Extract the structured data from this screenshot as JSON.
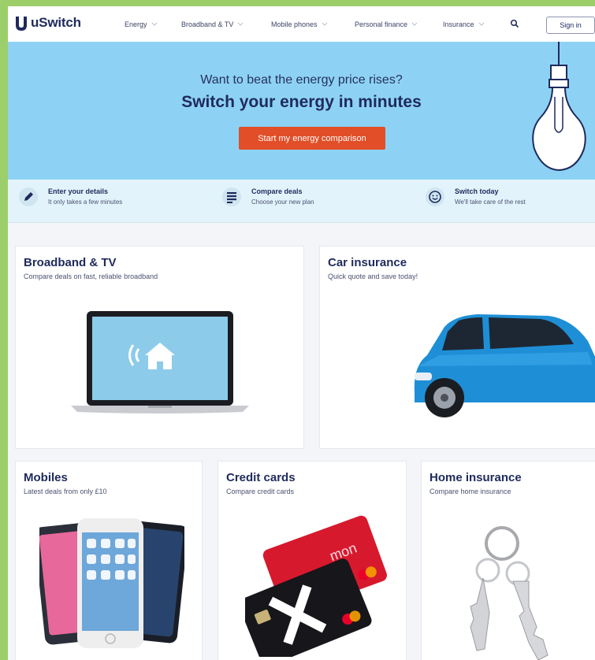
{
  "header": {
    "logo_text": "uSwitch",
    "nav": [
      "Energy",
      "Broadband & TV",
      "Mobile phones",
      "Personal finance",
      "Insurance"
    ],
    "sign_in": "Sign in"
  },
  "hero": {
    "subtitle": "Want to beat the energy price rises?",
    "title": "Switch your energy in minutes",
    "cta": "Start my energy comparison"
  },
  "steps": [
    {
      "title": "Enter your details",
      "desc": "It only takes a few minutes",
      "icon": "pencil-icon"
    },
    {
      "title": "Compare deals",
      "desc": "Choose your new plan",
      "icon": "list-icon"
    },
    {
      "title": "Switch today",
      "desc": "We'll take care of the rest",
      "icon": "smiley-icon"
    }
  ],
  "cards": [
    {
      "title": "Broadband & TV",
      "desc": "Compare deals on fast, reliable broadband",
      "image": "laptop-image"
    },
    {
      "title": "Car insurance",
      "desc": "Quick quote and save today!",
      "image": "car-image"
    },
    {
      "title": "Mobiles",
      "desc": "Latest deals from only £10",
      "image": "phones-image"
    },
    {
      "title": "Credit cards",
      "desc": "Compare credit cards",
      "image": "credit-cards-image"
    },
    {
      "title": "Home insurance",
      "desc": "Compare home insurance",
      "image": "keys-image"
    }
  ],
  "colors": {
    "brand_navy": "#1f2a5c",
    "hero_blue": "#8dd2f4",
    "cta_orange": "#e14e27",
    "frame_green": "#9ccf6a"
  }
}
